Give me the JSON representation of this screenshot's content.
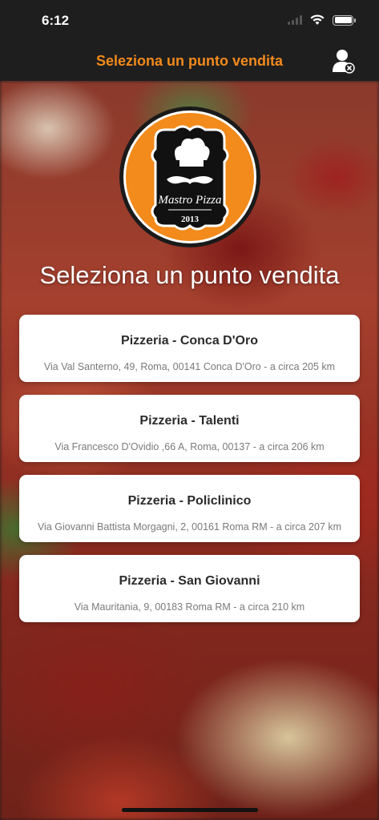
{
  "status_bar": {
    "time": "6:12"
  },
  "nav": {
    "title": "Seleziona un punto vendita",
    "user_icon": "user-remove-icon"
  },
  "logo": {
    "brand": "Mastro Pizza",
    "year": "2013",
    "icon": "chef-mustache-icon"
  },
  "headline": "Seleziona un punto vendita",
  "stores": [
    {
      "name": "Pizzeria - Conca D'Oro",
      "address": "Via Val Santerno, 49, Roma, 00141 Conca D'Oro - a circa 205 km"
    },
    {
      "name": "Pizzeria - Talenti",
      "address": "Via Francesco D'Ovidio ,66 A, Roma, 00137 - a circa 206 km"
    },
    {
      "name": "Pizzeria - Policlinico",
      "address": "Via Giovanni Battista Morgagni, 2, 00161 Roma RM - a circa 207 km"
    },
    {
      "name": "Pizzeria - San Giovanni",
      "address": "Via Mauritania, 9, 00183 Roma RM - a circa 210 km"
    }
  ],
  "colors": {
    "accent": "#f28a1c",
    "topbar": "#1e1e1e",
    "card": "#ffffff"
  }
}
